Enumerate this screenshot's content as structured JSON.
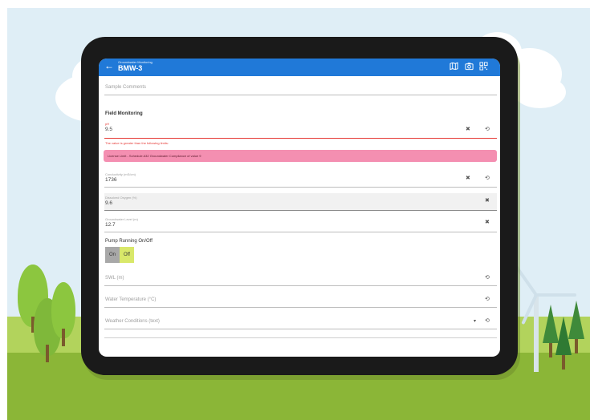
{
  "header": {
    "breadcrumb": "Groundwater Monitoring",
    "title": "BMW-3",
    "back_icon": "arrow-back-icon",
    "icons": [
      "map-icon",
      "camera-icon",
      "qr-code-icon"
    ]
  },
  "fields": {
    "sample_comments": {
      "placeholder": "Sample Comments"
    },
    "section_title": "Field Monitoring",
    "ph": {
      "label": "pH",
      "value": "9.5"
    },
    "ph_error": "The value is greater than the following limits:",
    "ph_alert": "License Limit - Schedule A32 Groundwater Compliance of value 9",
    "conductivity": {
      "label": "Conductivity (mS/cm)",
      "value": "1736"
    },
    "dissolved_oxygen": {
      "label": "Dissolved Oxygen (%)",
      "value": "9.6"
    },
    "groundwater_level": {
      "label": "Groundwater Level (m)",
      "value": "12.7"
    },
    "pump": {
      "label": "Pump Running On/Off",
      "on": "On",
      "off": "Off",
      "selected": "Off"
    },
    "swl": {
      "placeholder": "SWL (m)"
    },
    "water_temperature": {
      "placeholder": "Water Temperature (°C)"
    },
    "weather": {
      "placeholder": "Weather Conditions (text)"
    }
  },
  "colors": {
    "appbar": "#2079d8",
    "alert": "#f48fb1",
    "error": "#e53935",
    "toggle_selected": "#d9e86a"
  }
}
